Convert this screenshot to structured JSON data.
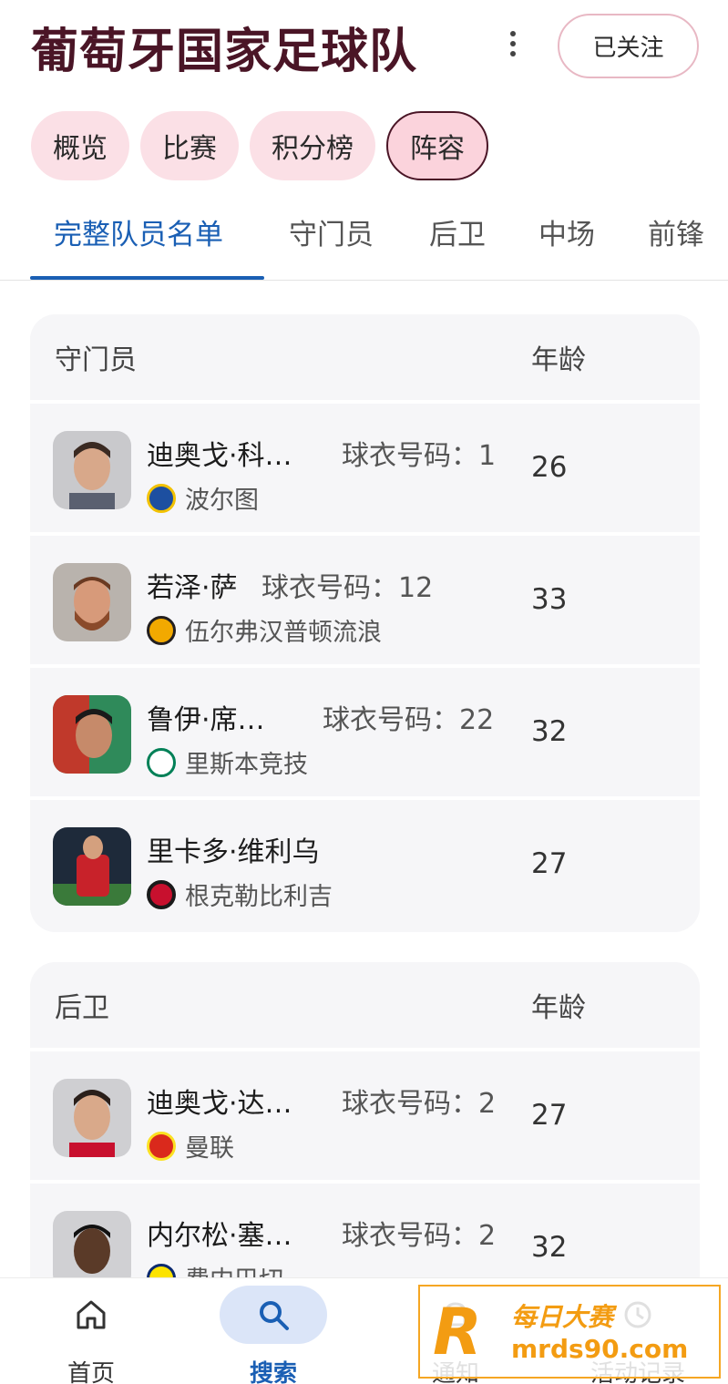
{
  "header": {
    "title": "葡萄牙国家足球队",
    "follow_label": "已关注"
  },
  "chips": [
    {
      "label": "概览"
    },
    {
      "label": "比赛"
    },
    {
      "label": "积分榜"
    },
    {
      "label": "阵容",
      "active": true
    }
  ],
  "tabs": [
    {
      "label": "完整队员名单",
      "active": true
    },
    {
      "label": "守门员"
    },
    {
      "label": "后卫"
    },
    {
      "label": "中场"
    },
    {
      "label": "前锋"
    }
  ],
  "sections": [
    {
      "position": "守门员",
      "age_header": "年龄",
      "players": [
        {
          "name": "迪奥戈·科…",
          "jersey": "球衣号码：1",
          "club": "波尔图",
          "age": "26"
        },
        {
          "name": "若泽·萨",
          "jersey": "球衣号码：12",
          "club": "伍尔弗汉普顿流浪",
          "age": "33"
        },
        {
          "name": "鲁伊·席…",
          "jersey": "球衣号码：22",
          "club": "里斯本竞技",
          "age": "32"
        },
        {
          "name": "里卡多·维利乌",
          "jersey": "",
          "club": "根克勒比利吉",
          "age": "27"
        }
      ]
    },
    {
      "position": "后卫",
      "age_header": "年龄",
      "players": [
        {
          "name": "迪奥戈·达…",
          "jersey": "球衣号码：2",
          "club": "曼联",
          "age": "27"
        },
        {
          "name": "内尔松·塞…",
          "jersey": "球衣号码：2",
          "club": "费内巴切",
          "age": "32"
        }
      ]
    }
  ],
  "bottom_nav": [
    {
      "label": "首页",
      "icon": "home-icon"
    },
    {
      "label": "搜索",
      "icon": "search-icon",
      "active": true
    },
    {
      "label": "通知",
      "icon": "bell-icon"
    },
    {
      "label": "活动记录",
      "icon": "history-icon"
    }
  ],
  "watermark": {
    "logo_letter": "R",
    "text": "每日大赛",
    "url": "mrds90.com"
  }
}
